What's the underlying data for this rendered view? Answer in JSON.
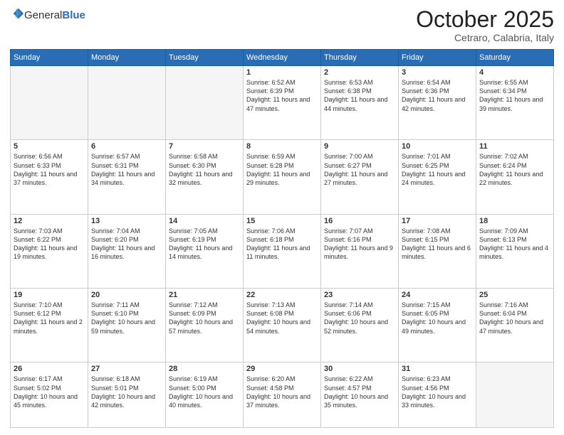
{
  "header": {
    "logo_general": "General",
    "logo_blue": "Blue",
    "month": "October 2025",
    "location": "Cetraro, Calabria, Italy"
  },
  "weekdays": [
    "Sunday",
    "Monday",
    "Tuesday",
    "Wednesday",
    "Thursday",
    "Friday",
    "Saturday"
  ],
  "weeks": [
    [
      {
        "day": "",
        "info": ""
      },
      {
        "day": "",
        "info": ""
      },
      {
        "day": "",
        "info": ""
      },
      {
        "day": "1",
        "info": "Sunrise: 6:52 AM\nSunset: 6:39 PM\nDaylight: 11 hours\nand 47 minutes."
      },
      {
        "day": "2",
        "info": "Sunrise: 6:53 AM\nSunset: 6:38 PM\nDaylight: 11 hours\nand 44 minutes."
      },
      {
        "day": "3",
        "info": "Sunrise: 6:54 AM\nSunset: 6:36 PM\nDaylight: 11 hours\nand 42 minutes."
      },
      {
        "day": "4",
        "info": "Sunrise: 6:55 AM\nSunset: 6:34 PM\nDaylight: 11 hours\nand 39 minutes."
      }
    ],
    [
      {
        "day": "5",
        "info": "Sunrise: 6:56 AM\nSunset: 6:33 PM\nDaylight: 11 hours\nand 37 minutes."
      },
      {
        "day": "6",
        "info": "Sunrise: 6:57 AM\nSunset: 6:31 PM\nDaylight: 11 hours\nand 34 minutes."
      },
      {
        "day": "7",
        "info": "Sunrise: 6:58 AM\nSunset: 6:30 PM\nDaylight: 11 hours\nand 32 minutes."
      },
      {
        "day": "8",
        "info": "Sunrise: 6:59 AM\nSunset: 6:28 PM\nDaylight: 11 hours\nand 29 minutes."
      },
      {
        "day": "9",
        "info": "Sunrise: 7:00 AM\nSunset: 6:27 PM\nDaylight: 11 hours\nand 27 minutes."
      },
      {
        "day": "10",
        "info": "Sunrise: 7:01 AM\nSunset: 6:25 PM\nDaylight: 11 hours\nand 24 minutes."
      },
      {
        "day": "11",
        "info": "Sunrise: 7:02 AM\nSunset: 6:24 PM\nDaylight: 11 hours\nand 22 minutes."
      }
    ],
    [
      {
        "day": "12",
        "info": "Sunrise: 7:03 AM\nSunset: 6:22 PM\nDaylight: 11 hours\nand 19 minutes."
      },
      {
        "day": "13",
        "info": "Sunrise: 7:04 AM\nSunset: 6:20 PM\nDaylight: 11 hours\nand 16 minutes."
      },
      {
        "day": "14",
        "info": "Sunrise: 7:05 AM\nSunset: 6:19 PM\nDaylight: 11 hours\nand 14 minutes."
      },
      {
        "day": "15",
        "info": "Sunrise: 7:06 AM\nSunset: 6:18 PM\nDaylight: 11 hours\nand 11 minutes."
      },
      {
        "day": "16",
        "info": "Sunrise: 7:07 AM\nSunset: 6:16 PM\nDaylight: 11 hours\nand 9 minutes."
      },
      {
        "day": "17",
        "info": "Sunrise: 7:08 AM\nSunset: 6:15 PM\nDaylight: 11 hours\nand 6 minutes."
      },
      {
        "day": "18",
        "info": "Sunrise: 7:09 AM\nSunset: 6:13 PM\nDaylight: 11 hours\nand 4 minutes."
      }
    ],
    [
      {
        "day": "19",
        "info": "Sunrise: 7:10 AM\nSunset: 6:12 PM\nDaylight: 11 hours\nand 2 minutes."
      },
      {
        "day": "20",
        "info": "Sunrise: 7:11 AM\nSunset: 6:10 PM\nDaylight: 10 hours\nand 59 minutes."
      },
      {
        "day": "21",
        "info": "Sunrise: 7:12 AM\nSunset: 6:09 PM\nDaylight: 10 hours\nand 57 minutes."
      },
      {
        "day": "22",
        "info": "Sunrise: 7:13 AM\nSunset: 6:08 PM\nDaylight: 10 hours\nand 54 minutes."
      },
      {
        "day": "23",
        "info": "Sunrise: 7:14 AM\nSunset: 6:06 PM\nDaylight: 10 hours\nand 52 minutes."
      },
      {
        "day": "24",
        "info": "Sunrise: 7:15 AM\nSunset: 6:05 PM\nDaylight: 10 hours\nand 49 minutes."
      },
      {
        "day": "25",
        "info": "Sunrise: 7:16 AM\nSunset: 6:04 PM\nDaylight: 10 hours\nand 47 minutes."
      }
    ],
    [
      {
        "day": "26",
        "info": "Sunrise: 6:17 AM\nSunset: 5:02 PM\nDaylight: 10 hours\nand 45 minutes."
      },
      {
        "day": "27",
        "info": "Sunrise: 6:18 AM\nSunset: 5:01 PM\nDaylight: 10 hours\nand 42 minutes."
      },
      {
        "day": "28",
        "info": "Sunrise: 6:19 AM\nSunset: 5:00 PM\nDaylight: 10 hours\nand 40 minutes."
      },
      {
        "day": "29",
        "info": "Sunrise: 6:20 AM\nSunset: 4:58 PM\nDaylight: 10 hours\nand 37 minutes."
      },
      {
        "day": "30",
        "info": "Sunrise: 6:22 AM\nSunset: 4:57 PM\nDaylight: 10 hours\nand 35 minutes."
      },
      {
        "day": "31",
        "info": "Sunrise: 6:23 AM\nSunset: 4:56 PM\nDaylight: 10 hours\nand 33 minutes."
      },
      {
        "day": "",
        "info": ""
      }
    ]
  ]
}
